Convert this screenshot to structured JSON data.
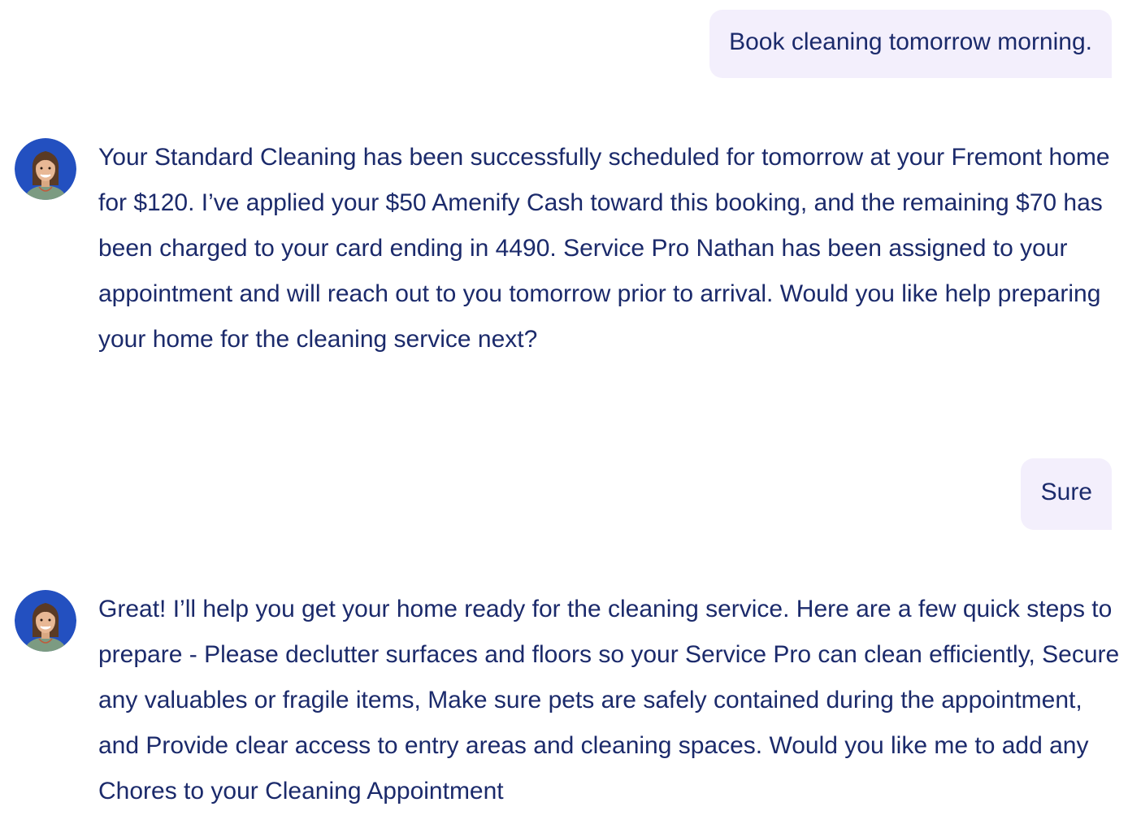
{
  "conversation": {
    "messages": [
      {
        "role": "user",
        "text": "Book cleaning tomorrow morning."
      },
      {
        "role": "assistant",
        "avatar": "agent-avatar-icon",
        "text": "Your Standard Cleaning has been successfully scheduled for tomorrow at your Fremont home for $120. I’ve applied your $50 Amenify Cash toward this booking, and the remaining $70 has been charged to your card ending in 4490. Service Pro Nathan has been assigned to your appointment and will reach out to you tomorrow prior to arrival. Would you like help preparing your home for the cleaning service next?"
      },
      {
        "role": "user",
        "text": "Sure"
      },
      {
        "role": "assistant",
        "avatar": "agent-avatar-icon",
        "text": "Great! I’ll help you get your home ready for the cleaning service. Here are a few quick steps to prepare - Please declutter surfaces and floors so your Service Pro can clean efficiently, Secure any valuables or fragile items, Make sure pets are safely contained during the appointment, and Provide clear access to entry areas and cleaning spaces. Would you like me to add any Chores to your Cleaning Appointment"
      }
    ]
  },
  "colors": {
    "text": "#1b2a6b",
    "user_bubble_bg": "#f3effc",
    "avatar_bg": "#2350c0",
    "background": "#ffffff"
  }
}
